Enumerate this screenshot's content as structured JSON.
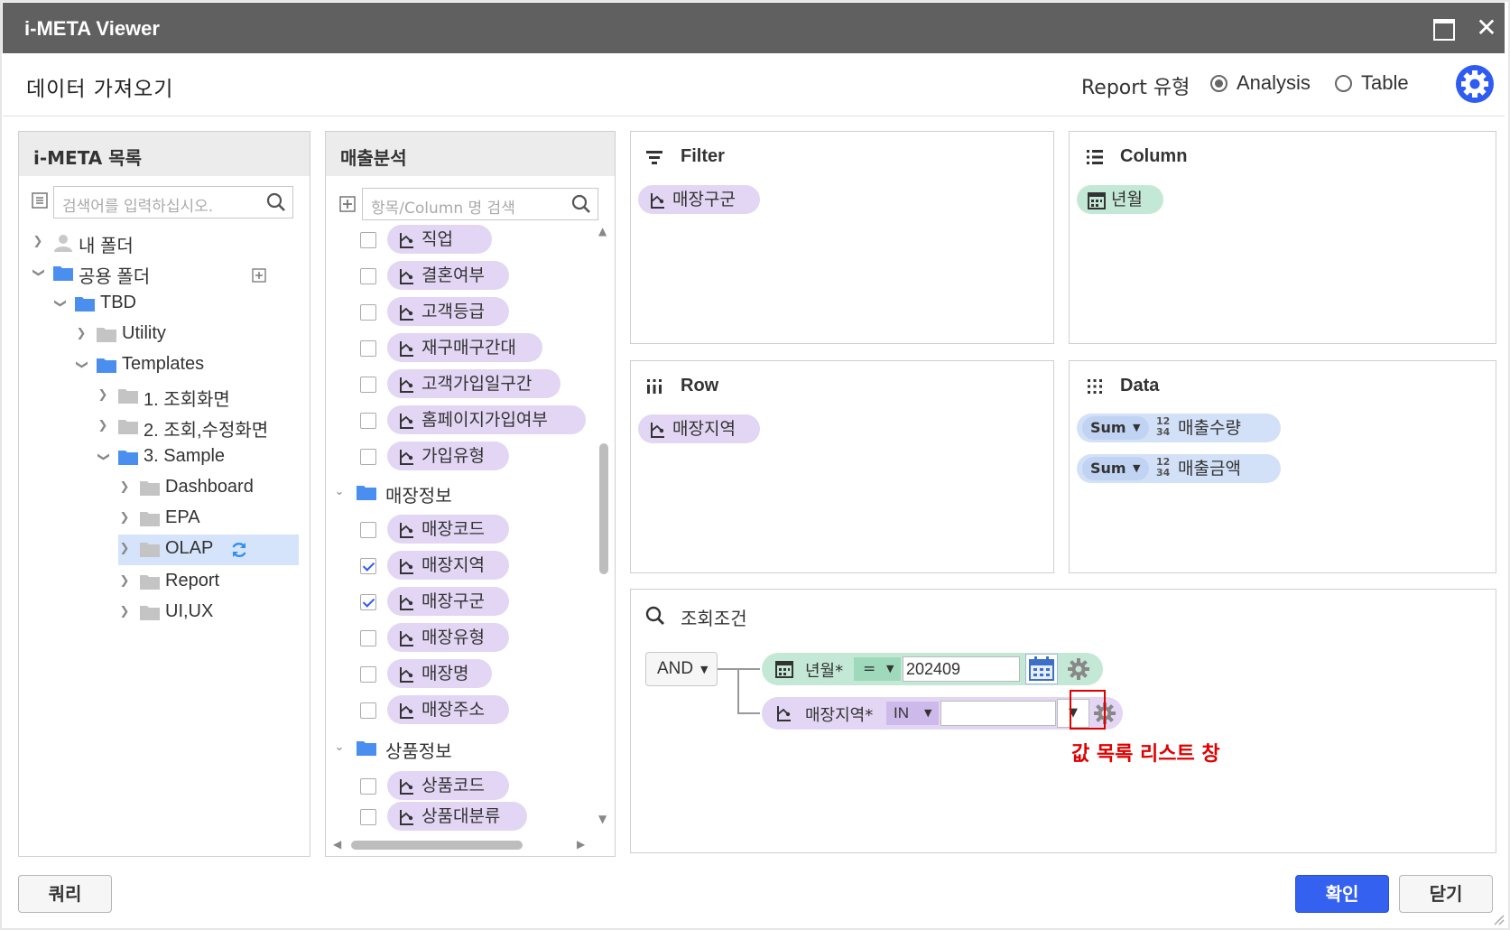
{
  "window": {
    "title": "i-META Viewer"
  },
  "header": {
    "title": "데이터 가져오기",
    "report_type_label": "Report 유형",
    "options": [
      {
        "label": "Analysis",
        "selected": true
      },
      {
        "label": "Table",
        "selected": false
      }
    ]
  },
  "left_panel": {
    "title": "i-META 목록",
    "search_placeholder": "검색어를 입력하십시오.",
    "tree": [
      {
        "label": "내 폴더",
        "icon": "user-icon",
        "expanded": false
      },
      {
        "label": "공용 폴더",
        "icon": "folder-icon",
        "expanded": true
      },
      {
        "label": "TBD",
        "icon": "folder-icon",
        "expanded": true
      },
      {
        "label": "Utility",
        "icon": "folder-icon",
        "expanded": false
      },
      {
        "label": "Templates",
        "icon": "folder-icon",
        "expanded": true
      },
      {
        "label": "1. 조회화면",
        "icon": "folder-icon",
        "expanded": false
      },
      {
        "label": "2. 조회,수정화면",
        "icon": "folder-icon",
        "expanded": false
      },
      {
        "label": "3. Sample",
        "icon": "folder-icon",
        "expanded": true
      },
      {
        "label": "Dashboard",
        "icon": "folder-icon",
        "expanded": false
      },
      {
        "label": "EPA",
        "icon": "folder-icon",
        "expanded": false
      },
      {
        "label": "OLAP",
        "icon": "folder-icon",
        "expanded": false,
        "selected": true
      },
      {
        "label": "Report",
        "icon": "folder-icon",
        "expanded": false
      },
      {
        "label": "UI,UX",
        "icon": "folder-icon",
        "expanded": false
      }
    ]
  },
  "middle_panel": {
    "title": "매출분석",
    "search_placeholder": "항목/Column 명 검색",
    "items": [
      {
        "type": "field",
        "label": "직업",
        "checked": false
      },
      {
        "type": "field",
        "label": "결혼여부",
        "checked": false
      },
      {
        "type": "field",
        "label": "고객등급",
        "checked": false
      },
      {
        "type": "field",
        "label": "재구매구간대",
        "checked": false
      },
      {
        "type": "field",
        "label": "고객가입일구간",
        "checked": false
      },
      {
        "type": "field",
        "label": "홈페이지가입여부",
        "checked": false
      },
      {
        "type": "field",
        "label": "가입유형",
        "checked": false
      },
      {
        "type": "group",
        "label": "매장정보"
      },
      {
        "type": "field",
        "label": "매장코드",
        "checked": false
      },
      {
        "type": "field",
        "label": "매장지역",
        "checked": true
      },
      {
        "type": "field",
        "label": "매장구군",
        "checked": true
      },
      {
        "type": "field",
        "label": "매장유형",
        "checked": false
      },
      {
        "type": "field",
        "label": "매장명",
        "checked": false
      },
      {
        "type": "field",
        "label": "매장주소",
        "checked": false
      },
      {
        "type": "group",
        "label": "상품정보"
      },
      {
        "type": "field",
        "label": "상품코드",
        "checked": false
      },
      {
        "type": "field",
        "label": "상품대분류",
        "checked": false
      }
    ]
  },
  "filter_box": {
    "title": "Filter",
    "items": [
      "매장구군"
    ]
  },
  "column_box": {
    "title": "Column",
    "items": [
      "년월"
    ]
  },
  "row_box": {
    "title": "Row",
    "items": [
      "매장지역"
    ]
  },
  "data_box": {
    "title": "Data",
    "items": [
      {
        "agg": "Sum",
        "label": "매출수량"
      },
      {
        "agg": "Sum",
        "label": "매출금액"
      }
    ]
  },
  "condition_box": {
    "title": "조회조건",
    "logic": "AND",
    "conditions": [
      {
        "field": "년월*",
        "operator": "=",
        "value": "202409"
      },
      {
        "field": "매장지역*",
        "operator": "IN",
        "value": ""
      }
    ],
    "annotation": "값 목록 리스트 창"
  },
  "footer": {
    "query_label": "쿼리",
    "confirm_label": "확인",
    "close_label": "닫기"
  },
  "colors": {
    "accent": "#3461f0",
    "titlebar": "#606060",
    "dimension_pill": "#e2d6f4",
    "date_pill": "#c4e8d6",
    "measure_pill": "#d3e1f8",
    "annotation": "#e00000"
  }
}
